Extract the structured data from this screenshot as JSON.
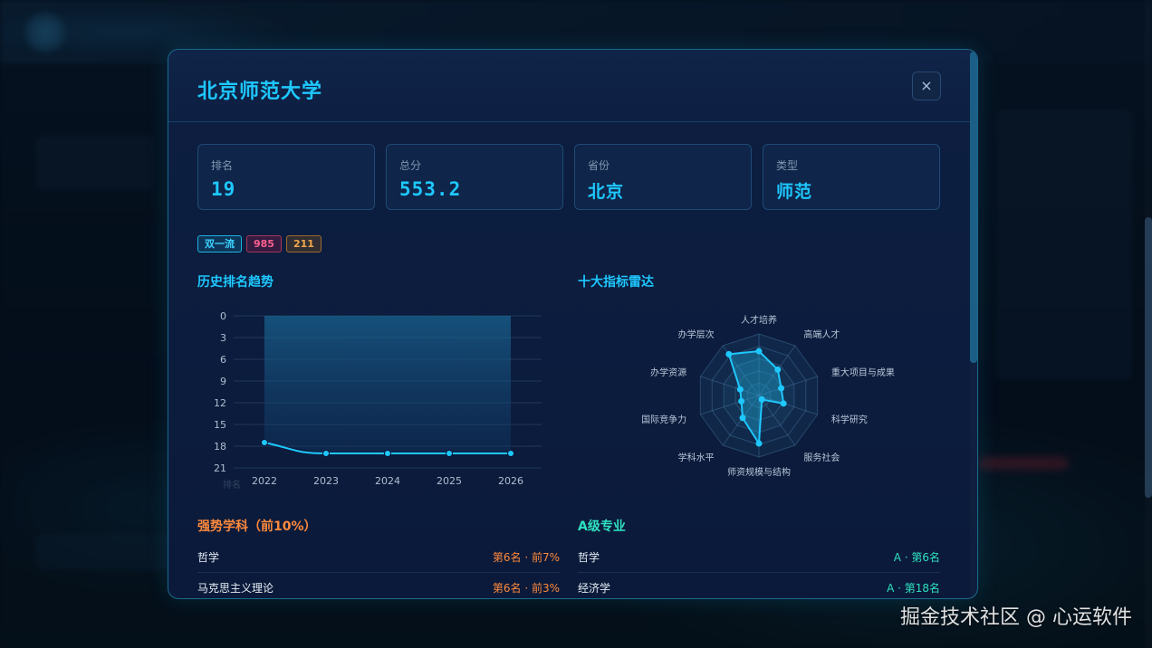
{
  "modal": {
    "title": "北京师范大学",
    "close_label": "×"
  },
  "stats": [
    {
      "label": "排名",
      "value": "19"
    },
    {
      "label": "总分",
      "value": "553.2"
    },
    {
      "label": "省份",
      "value": "北京"
    },
    {
      "label": "类型",
      "value": "师范"
    }
  ],
  "tags": [
    {
      "label": "双一流",
      "color": "#1eb3e0"
    },
    {
      "label": "985",
      "color": "#ff5f8f"
    },
    {
      "label": "211",
      "color": "#f1a84a"
    }
  ],
  "sections": {
    "history": "历史排名趋势",
    "radar": "十大指标雷达",
    "strong": "强势学科（前10%）",
    "major": "A级专业"
  },
  "chart_data": [
    {
      "type": "area",
      "title": "历史排名趋势",
      "categories": [
        "2022",
        "2023",
        "2024",
        "2025",
        "2026"
      ],
      "series": [
        {
          "values": [
            17.5,
            19,
            19,
            19,
            19
          ]
        }
      ],
      "ylim": [
        0,
        21
      ],
      "y_ticks": [
        "0",
        "3",
        "6",
        "9",
        "12",
        "15",
        "18",
        "21"
      ],
      "y_inverted": true,
      "ylabel": "排名",
      "grid": true,
      "color": "#1ec8ff"
    },
    {
      "type": "radar",
      "title": "十大指标雷达",
      "indicators": [
        "人才培养",
        "高端人才",
        "重大项目与成果",
        "科学研究",
        "服务社会",
        "师资规模与结构",
        "学科水平",
        "国际竞争力",
        "办学资源",
        "办学层次"
      ],
      "values": [
        0.72,
        0.52,
        0.38,
        0.42,
        0.08,
        0.78,
        0.45,
        0.3,
        0.32,
        0.83
      ],
      "color": "#1ec8ff"
    }
  ],
  "strong_subjects": [
    {
      "name": "哲学",
      "value": "第6名 · 前7%"
    },
    {
      "name": "马克思主义理论",
      "value": "第6名 · 前3%"
    }
  ],
  "a_majors": [
    {
      "name": "哲学",
      "value": "A · 第6名"
    },
    {
      "name": "经济学",
      "value": "A · 第18名"
    }
  ],
  "watermark": "掘金技术社区 @ 心运软件"
}
